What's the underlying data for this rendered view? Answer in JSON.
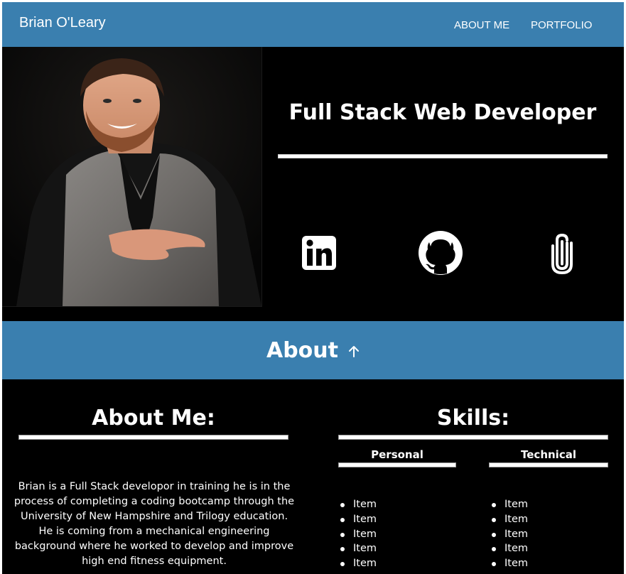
{
  "navbar": {
    "brand": "Brian O'Leary",
    "links": [
      "ABOUT ME",
      "PORTFOLIO"
    ],
    "color": "#3a7faf"
  },
  "hero": {
    "title": "Full Stack Web Developer",
    "photo_icon": "profile-photo",
    "social": [
      "linkedin-icon",
      "github-icon",
      "paperclip-icon"
    ]
  },
  "about_band": {
    "title": "About",
    "icon": "arrow-up-icon"
  },
  "about": {
    "title": "About Me:",
    "bio": "Brian is a Full Stack developor in training he is in the process of completing a coding bootcamp through the University of New Hampshire and Trilogy education. He is coming from a mechanical engineering background where he worked to develop and improve high end fitness equipment."
  },
  "skills": {
    "title": "Skills:",
    "personal": {
      "title": "Personal",
      "items": [
        "Item",
        "Item",
        "Item",
        "Item",
        "Item"
      ]
    },
    "technical": {
      "title": "Technical",
      "items": [
        "Item",
        "Item",
        "Item",
        "Item",
        "Item"
      ]
    }
  },
  "colors": {
    "accent": "#3a7faf",
    "background": "#000000",
    "text": "#ffffff"
  }
}
